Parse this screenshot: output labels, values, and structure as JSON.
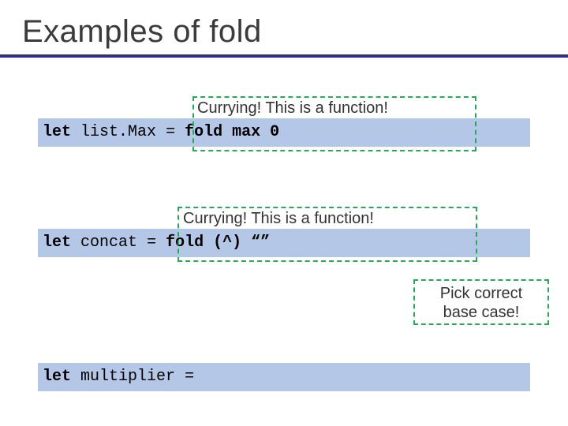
{
  "title": "Examples of fold",
  "blocks": {
    "listMax": {
      "let": "let",
      "ident": "list.Max",
      "eq": "=",
      "fold": "fold max 0"
    },
    "concat": {
      "let": "let",
      "ident": "concat",
      "eq": "=",
      "fold": "fold (^) “”"
    },
    "multiplier": {
      "let": "let",
      "ident": "multiplier",
      "eq": "="
    }
  },
  "callouts": {
    "currying1": "Currying! This is a function!",
    "currying2": "Currying! This is a function!",
    "base_case_line1": "Pick correct",
    "base_case_line2": "base case!"
  },
  "colors": {
    "rule": "#2f2e8a",
    "code_bg": "#b4c7e7",
    "dashed": "#2aa858"
  }
}
